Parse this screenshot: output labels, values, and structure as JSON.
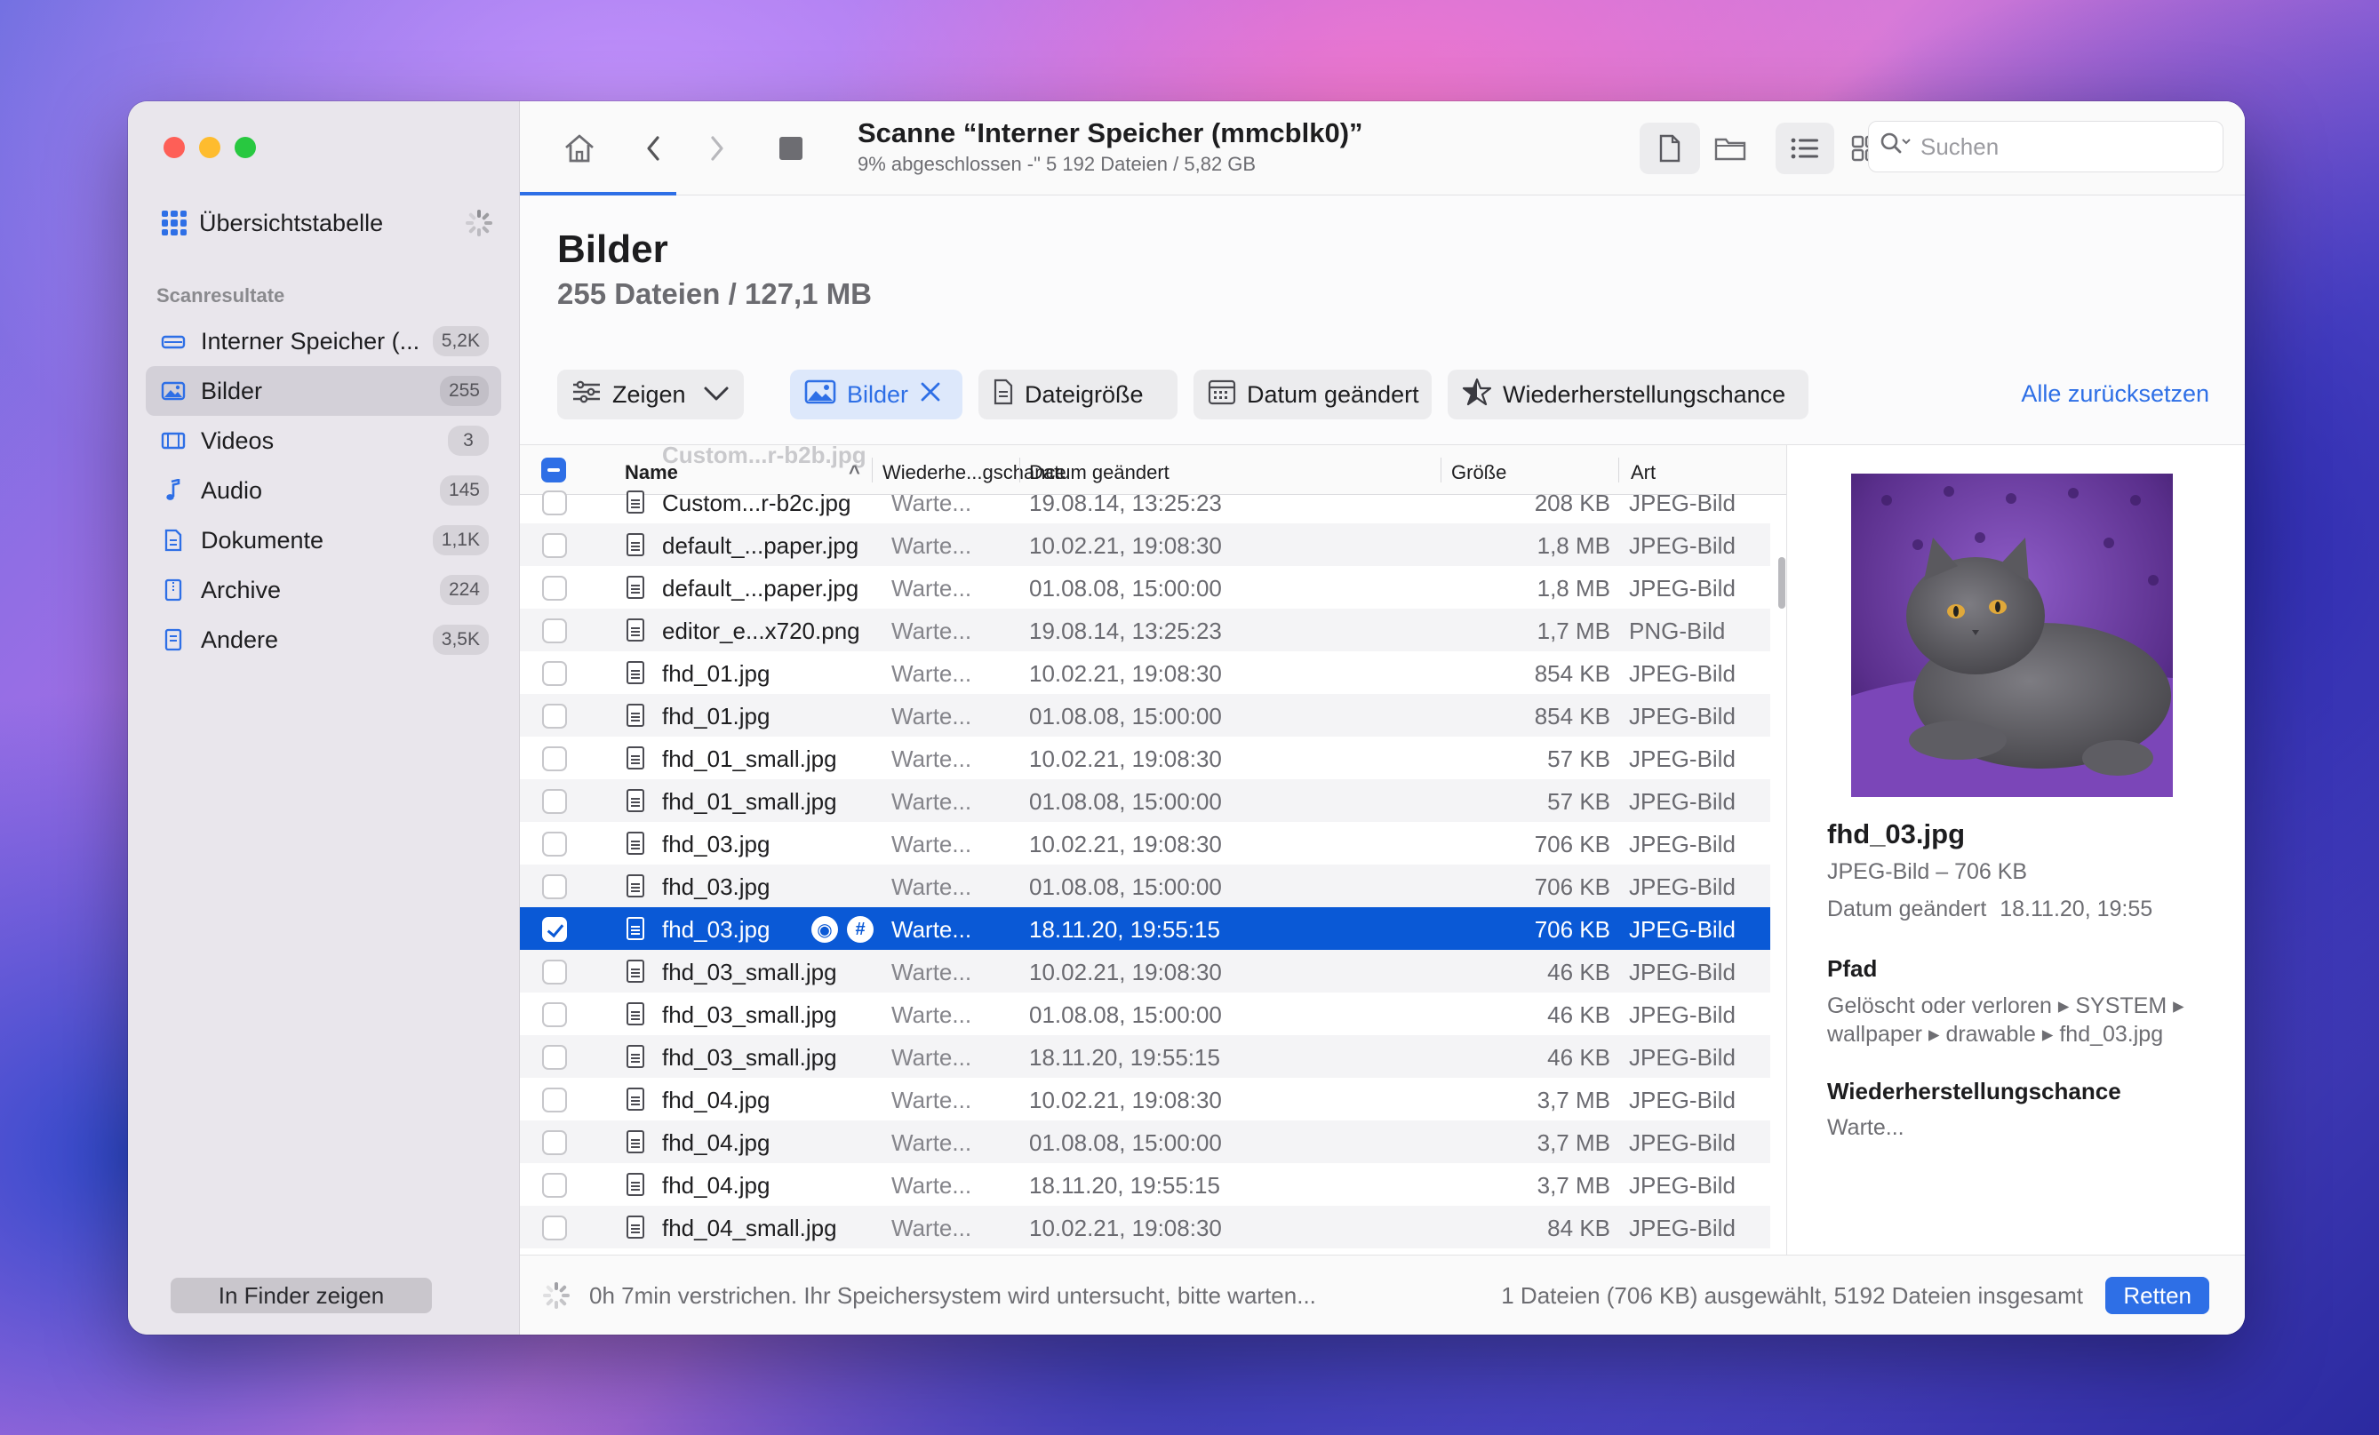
{
  "sidebar": {
    "overview_label": "Übersichtstabelle",
    "section_title": "Scanresultate",
    "items": [
      {
        "label": "Interner Speicher (...",
        "count": "5,2K",
        "icon": "drive-icon"
      },
      {
        "label": "Bilder",
        "count": "255",
        "icon": "image-icon"
      },
      {
        "label": "Videos",
        "count": "3",
        "icon": "film-icon"
      },
      {
        "label": "Audio",
        "count": "145",
        "icon": "music-note-icon"
      },
      {
        "label": "Dokumente",
        "count": "1,1K",
        "icon": "document-icon"
      },
      {
        "label": "Archive",
        "count": "224",
        "icon": "archive-icon"
      },
      {
        "label": "Andere",
        "count": "3,5K",
        "icon": "file-icon"
      }
    ],
    "finder_button": "In Finder zeigen"
  },
  "toolbar": {
    "scan_title": "Scanne “Interner Speicher (mmcblk0)”",
    "scan_subtitle": "9% abgeschlossen -\" 5 192 Dateien / 5,82 GB",
    "search_placeholder": "Suchen"
  },
  "main": {
    "title": "Bilder",
    "subtitle": "255 Dateien / 127,1 MB",
    "filters": {
      "show": "Zeigen",
      "images": "Bilder",
      "filesize": "Dateigröße",
      "date_changed": "Datum geändert",
      "recovery_chance": "Wiederherstellungschance",
      "reset_all": "Alle zurücksetzen"
    }
  },
  "table": {
    "headers": {
      "name": "Name",
      "chance": "Wiederhe...gschance",
      "date": "Datum geändert",
      "size": "Größe",
      "type": "Art"
    },
    "ghost_top": "Custom...r-b2b.jpg",
    "rows": [
      {
        "name": "Custom...r-b2c.jpg",
        "chance": "Warte...",
        "date": "19.08.14, 13:25:23",
        "size": "208 KB",
        "type": "JPEG-Bild"
      },
      {
        "name": "default_...paper.jpg",
        "chance": "Warte...",
        "date": "10.02.21, 19:08:30",
        "size": "1,8 MB",
        "type": "JPEG-Bild"
      },
      {
        "name": "default_...paper.jpg",
        "chance": "Warte...",
        "date": "01.08.08, 15:00:00",
        "size": "1,8 MB",
        "type": "JPEG-Bild"
      },
      {
        "name": "editor_e...x720.png",
        "chance": "Warte...",
        "date": "19.08.14, 13:25:23",
        "size": "1,7 MB",
        "type": "PNG-Bild"
      },
      {
        "name": "fhd_01.jpg",
        "chance": "Warte...",
        "date": "10.02.21, 19:08:30",
        "size": "854 KB",
        "type": "JPEG-Bild"
      },
      {
        "name": "fhd_01.jpg",
        "chance": "Warte...",
        "date": "01.08.08, 15:00:00",
        "size": "854 KB",
        "type": "JPEG-Bild"
      },
      {
        "name": "fhd_01_small.jpg",
        "chance": "Warte...",
        "date": "10.02.21, 19:08:30",
        "size": "57 KB",
        "type": "JPEG-Bild"
      },
      {
        "name": "fhd_01_small.jpg",
        "chance": "Warte...",
        "date": "01.08.08, 15:00:00",
        "size": "57 KB",
        "type": "JPEG-Bild"
      },
      {
        "name": "fhd_03.jpg",
        "chance": "Warte...",
        "date": "10.02.21, 19:08:30",
        "size": "706 KB",
        "type": "JPEG-Bild"
      },
      {
        "name": "fhd_03.jpg",
        "chance": "Warte...",
        "date": "01.08.08, 15:00:00",
        "size": "706 KB",
        "type": "JPEG-Bild"
      },
      {
        "name": "fhd_03.jpg",
        "chance": "Warte...",
        "date": "18.11.20, 19:55:15",
        "size": "706 KB",
        "type": "JPEG-Bild",
        "selected": true
      },
      {
        "name": "fhd_03_small.jpg",
        "chance": "Warte...",
        "date": "10.02.21, 19:08:30",
        "size": "46 KB",
        "type": "JPEG-Bild"
      },
      {
        "name": "fhd_03_small.jpg",
        "chance": "Warte...",
        "date": "01.08.08, 15:00:00",
        "size": "46 KB",
        "type": "JPEG-Bild"
      },
      {
        "name": "fhd_03_small.jpg",
        "chance": "Warte...",
        "date": "18.11.20, 19:55:15",
        "size": "46 KB",
        "type": "JPEG-Bild"
      },
      {
        "name": "fhd_04.jpg",
        "chance": "Warte...",
        "date": "10.02.21, 19:08:30",
        "size": "3,7 MB",
        "type": "JPEG-Bild"
      },
      {
        "name": "fhd_04.jpg",
        "chance": "Warte...",
        "date": "01.08.08, 15:00:00",
        "size": "3,7 MB",
        "type": "JPEG-Bild"
      },
      {
        "name": "fhd_04.jpg",
        "chance": "Warte...",
        "date": "18.11.20, 19:55:15",
        "size": "3,7 MB",
        "type": "JPEG-Bild"
      },
      {
        "name": "fhd_04_small.jpg",
        "chance": "Warte...",
        "date": "10.02.21, 19:08:30",
        "size": "84 KB",
        "type": "JPEG-Bild"
      }
    ]
  },
  "preview": {
    "filename": "fhd_03.jpg",
    "type_size": "JPEG-Bild – 706 KB",
    "date_label": "Datum geändert",
    "date_value": "18.11.20, 19:55",
    "path_title": "Pfad",
    "path_line1": "Gelöscht oder verloren ▸ SYSTEM ▸",
    "path_line2": "wallpaper ▸ drawable ▸ fhd_03.jpg",
    "chance_title": "Wiederherstellungschance",
    "chance_value": "Warte..."
  },
  "status": {
    "progress_text": "0h 7min verstrichen. Ihr Speichersystem wird untersucht, bitte warten...",
    "selection_text": "1 Dateien (706 KB) ausgewählt, 5192 Dateien insgesamt",
    "recover_button": "Retten"
  },
  "colors": {
    "accent": "#2e6fe6",
    "selection": "#0a59d6",
    "sidebar_bg": "#e9e6ec"
  }
}
